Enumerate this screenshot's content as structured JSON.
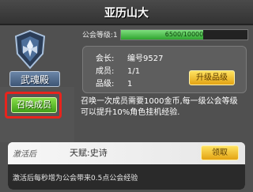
{
  "header": {
    "title": "亚历山大"
  },
  "guild": {
    "name": "武魂殿",
    "summon_button": "召唤成员"
  },
  "level": {
    "label": "公会等级:1",
    "progress_text": "6500/10000",
    "progress_fraction": 0.65
  },
  "info": {
    "president_key": "会长:",
    "president_val": "编号9527",
    "members_key": "成员:",
    "members_val": "1/1",
    "rank_key": "品级:",
    "rank_val": "1",
    "upgrade_button": "升级品级"
  },
  "description": "召唤一次成员需要1000金币,每一级公会等级可以提升10%角色挂机经验.",
  "card": {
    "tag": "激活后",
    "name": "天赋:史诗",
    "button": "领取",
    "text": "激活后每秒增为公会带来0.5点公会经验"
  },
  "colors": {
    "summon": "#3f9e18",
    "highlight": "#e8241d",
    "accent": "#e3a313"
  }
}
